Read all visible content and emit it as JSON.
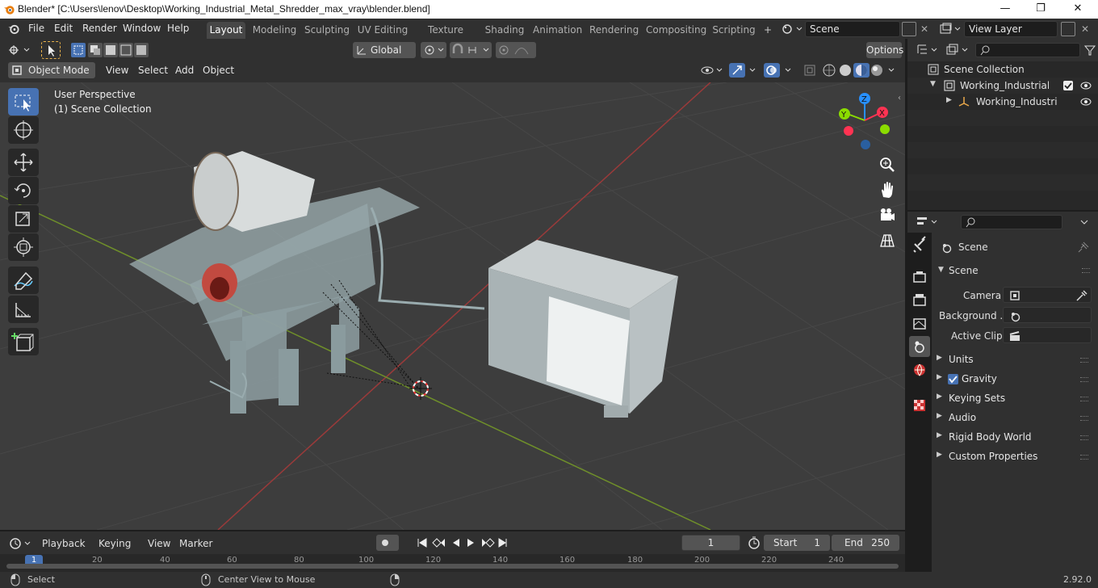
{
  "window": {
    "title": "Blender* [C:\\Users\\lenov\\Desktop\\Working_Industrial_Metal_Shredder_max_vray\\blender.blend]",
    "minimize": "—",
    "maximize": "❐",
    "close": "✕"
  },
  "menu": {
    "items": [
      "File",
      "Edit",
      "Render",
      "Window",
      "Help"
    ]
  },
  "workspaces": {
    "tabs": [
      "Layout",
      "Modeling",
      "Sculpting",
      "UV Editing",
      "Texture Paint",
      "Shading",
      "Animation",
      "Rendering",
      "Compositing",
      "Scripting"
    ],
    "add": "+",
    "scene_name": "Scene",
    "view_layer": "View Layer"
  },
  "viewport_header": {
    "transform_orientation": "Global",
    "options": "Options",
    "mode": "Object Mode",
    "menus": [
      "View",
      "Select",
      "Add",
      "Object"
    ]
  },
  "viewport": {
    "perspective_label": "User Perspective",
    "collection_label": "(1) Scene Collection",
    "gizmo": {
      "x": "X",
      "y": "Y",
      "z": "Z"
    }
  },
  "outliner": {
    "root": "Scene Collection",
    "items": [
      "Working_Industrial_Meta",
      "Working_Industrial_N"
    ]
  },
  "properties": {
    "header": "Scene",
    "section": "Scene",
    "fields": {
      "camera_label": "Camera",
      "background_label": "Background ...",
      "active_clip_label": "Active Clip"
    },
    "panels": [
      "Units",
      "Gravity",
      "Keying Sets",
      "Audio",
      "Rigid Body World",
      "Custom Properties"
    ],
    "gravity_checked": true
  },
  "timeline": {
    "menus": [
      "Playback",
      "Keying",
      "View",
      "Marker"
    ],
    "current_frame": "1",
    "start_label": "Start",
    "start_value": "1",
    "end_label": "End",
    "end_value": "250",
    "ruler_current": "1",
    "ruler_ticks": [
      "20",
      "40",
      "60",
      "80",
      "100",
      "120",
      "140",
      "160",
      "180",
      "200",
      "220",
      "240"
    ]
  },
  "status_bar": {
    "select": "Select",
    "center_view": "Center View to Mouse",
    "version": "2.92.0"
  },
  "colors": {
    "accent": "#4772b3",
    "axis_x": "#ff3352",
    "axis_y": "#8bdc00",
    "axis_z": "#2890ff",
    "grid_red": "#9a3a3a",
    "grid_green": "#6f8f2a"
  }
}
